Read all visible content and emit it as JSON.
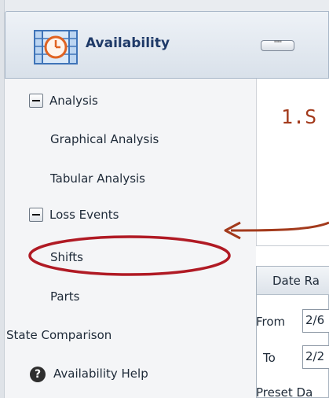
{
  "header": {
    "title": "Availability",
    "collapse_label": "\"\"\""
  },
  "nav": {
    "groups": [
      {
        "label": "Analysis",
        "expanded": true
      },
      {
        "label": "Loss Events",
        "expanded": true
      }
    ],
    "items": {
      "graphical_analysis": "Graphical Analysis",
      "tabular_analysis": "Tabular Analysis",
      "shifts": "Shifts",
      "parts": "Parts",
      "state_comparison": "State Comparison",
      "availability_help": "Availability Help"
    },
    "help_icon_glyph": "?"
  },
  "annotation": {
    "step_text": "1.S",
    "color": "#a33a1c"
  },
  "panel": {
    "title": "Date Ra",
    "from_label": "From",
    "from_value": "2/6",
    "to_label": "To",
    "to_value": "2/2",
    "preset_label": "Preset Da"
  },
  "colors": {
    "header_title": "#1f3a68",
    "annotation": "#a33a1c",
    "nav_background": "#f4f5f7"
  }
}
